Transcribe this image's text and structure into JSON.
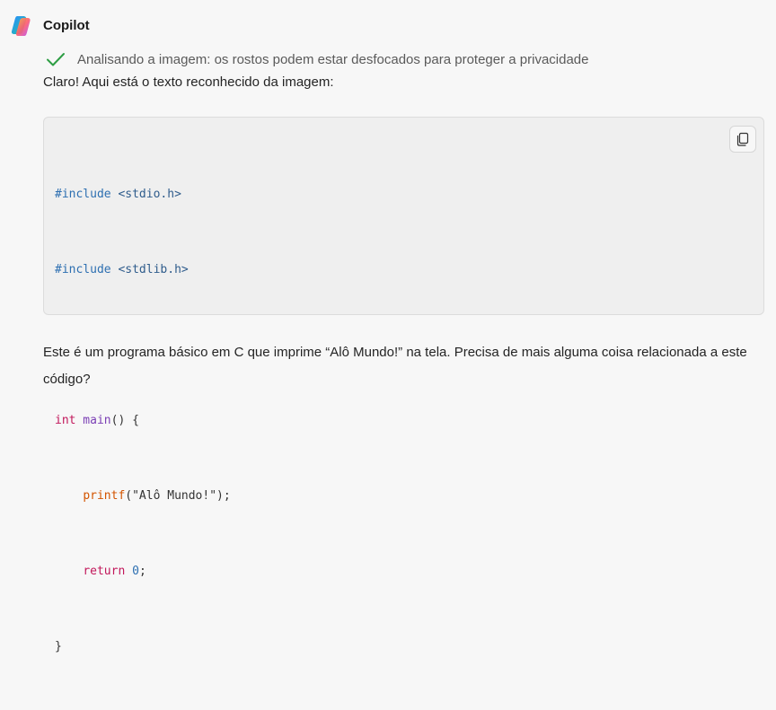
{
  "header": {
    "brand": "Copilot",
    "logo_icon": "copilot-logo-icon"
  },
  "status": {
    "icon": "checkmark-icon",
    "text": "Analisando a imagem: os rostos podem estar desfocados para proteger a privacidade"
  },
  "message": {
    "intro": "Claro! Aqui está o texto reconhecido da imagem:",
    "outro": "Este é um programa básico em C que imprime “Alô Mundo!” na tela. Precisa de mais alguma coisa relacionada a este código?"
  },
  "code": {
    "language": "c",
    "copy_icon": "copy-icon",
    "lines": [
      "#include <stdio.h>",
      "#include <stdlib.h>",
      "",
      "int main() {",
      "    printf(\"Alô Mundo!\");",
      "    return 0;",
      "}"
    ],
    "tokens": {
      "l1_pre": "#include",
      "l1_arg": " <stdio.h>",
      "l2_pre": "#include",
      "l2_arg": " <stdlib.h>",
      "l4_kw": "int",
      "l4_fn": " main",
      "l4_rest": "() {",
      "l5_indent": "    ",
      "l5_call": "printf",
      "l5_rest": "(\"Alô Mundo!\");",
      "l6_indent": "    ",
      "l6_kw": "return",
      "l6_sp": " ",
      "l6_num": "0",
      "l6_end": ";",
      "l7": "}"
    }
  },
  "colors": {
    "background": "#f7f7f7",
    "code_background": "#efefef",
    "check_green": "#2e9e44"
  }
}
